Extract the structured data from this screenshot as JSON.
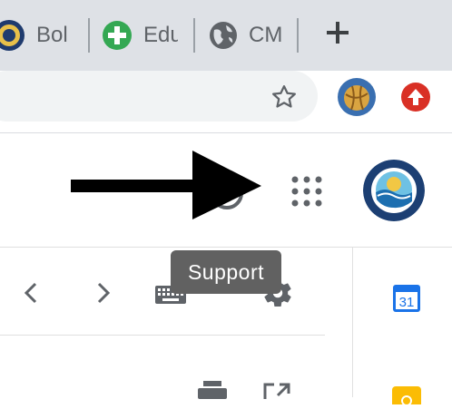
{
  "browser": {
    "tabs": [
      {
        "title": "Bol",
        "icon": "club-logo-icon"
      },
      {
        "title": "Edu",
        "icon": "green-plus-icon"
      },
      {
        "title": "CM",
        "icon": "globe-icon"
      }
    ],
    "new_tab_icon": "plus-icon"
  },
  "toolbar": {
    "bookmark_icon": "star-icon",
    "extension_avatar_icon": "water-polo-ball-icon",
    "update_icon": "red-up-arrow-icon"
  },
  "gmail": {
    "apps_icon": "apps-grid-icon",
    "account_icon": "swim-club-logo-icon",
    "tooltip": "Support",
    "accent": "#1a73e8"
  }
}
